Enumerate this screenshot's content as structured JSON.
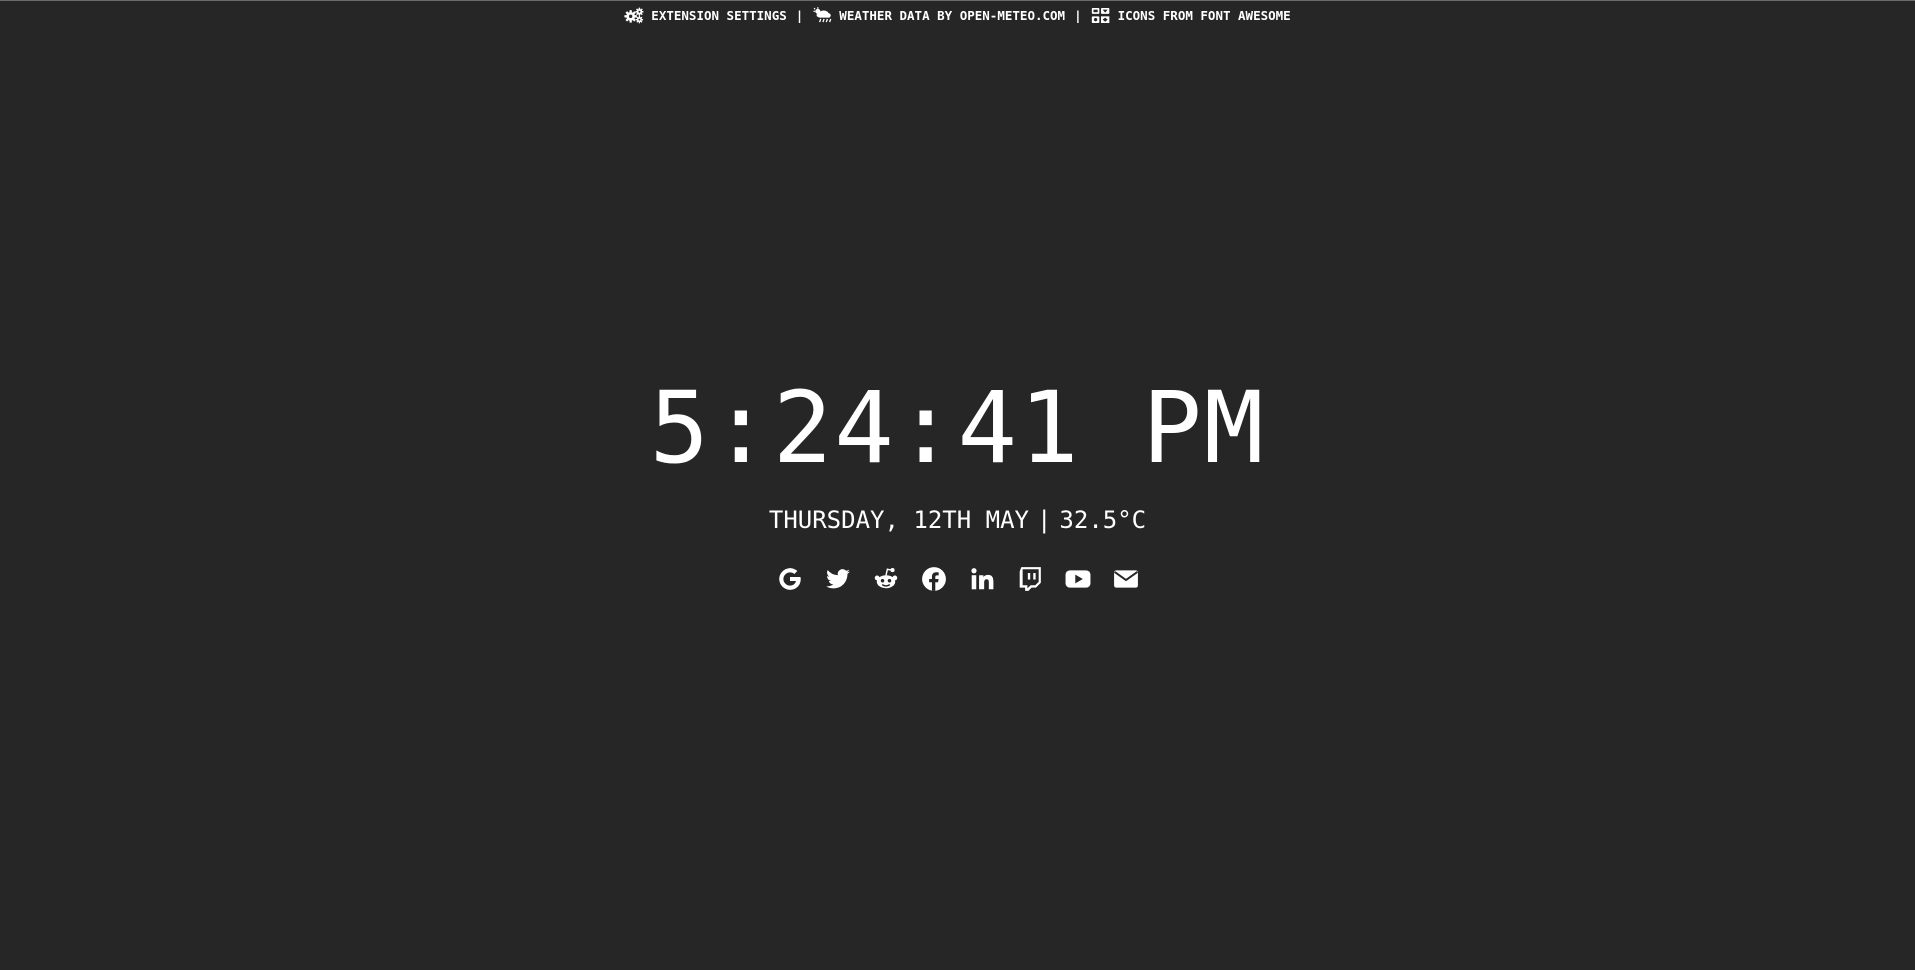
{
  "colors": {
    "background": "#262626",
    "text": "#ffffff"
  },
  "topbar": {
    "settings_label": "EXTENSION SETTINGS",
    "settings_icon": "gears-icon",
    "separator": "|",
    "weather_label": "WEATHER DATA BY OPEN-METEO.COM",
    "weather_icon": "cloud-sun-rain-icon",
    "icons_label": "ICONS FROM FONT AWESOME",
    "icons_icon": "font-awesome-icon"
  },
  "clock": {
    "time": "5:24:41 PM"
  },
  "dateline": {
    "date": "THURSDAY, 12TH MAY",
    "separator": "|",
    "temperature": "32.5°C"
  },
  "links": [
    {
      "name": "Google",
      "icon": "google-icon"
    },
    {
      "name": "Twitter",
      "icon": "twitter-icon"
    },
    {
      "name": "Reddit",
      "icon": "reddit-icon"
    },
    {
      "name": "Facebook",
      "icon": "facebook-icon"
    },
    {
      "name": "LinkedIn",
      "icon": "linkedin-icon"
    },
    {
      "name": "Twitch",
      "icon": "twitch-icon"
    },
    {
      "name": "YouTube",
      "icon": "youtube-icon"
    },
    {
      "name": "Email",
      "icon": "envelope-icon"
    }
  ]
}
